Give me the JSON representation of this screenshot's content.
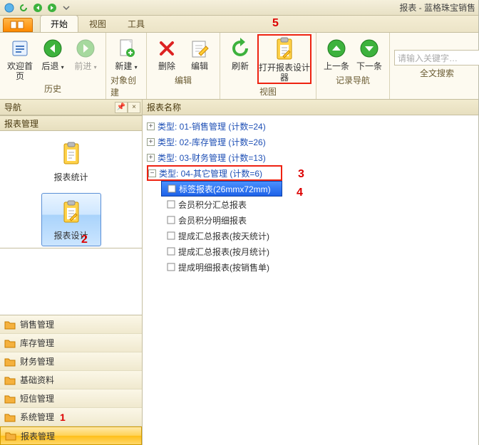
{
  "window": {
    "title": "报表 - 蓝格珠宝销售"
  },
  "qat": {
    "items": [
      {
        "name": "app-logo-icon",
        "glyph": "logo",
        "color": "#2a90d8"
      },
      {
        "name": "refresh-icon",
        "glyph": "refresh",
        "color": "#2fa82f"
      },
      {
        "name": "nav-back-icon",
        "glyph": "back-round",
        "color": "#2fa82f"
      },
      {
        "name": "nav-forward-icon",
        "glyph": "forward-round",
        "color": "#2fa82f"
      },
      {
        "name": "dropdown-icon",
        "glyph": "chevron-down",
        "color": "#888"
      }
    ]
  },
  "tabs": {
    "items": [
      {
        "label": "开始",
        "active": true
      },
      {
        "label": "视图",
        "active": false
      },
      {
        "label": "工具",
        "active": false
      }
    ]
  },
  "annotations": {
    "a1": "1",
    "a2": "2",
    "a3": "3",
    "a4": "4",
    "a5": "5"
  },
  "ribbon": {
    "groups": [
      {
        "label": "历史",
        "buttons": [
          {
            "name": "home-button",
            "label": "欢迎首页",
            "glyph": "home",
            "disabled": false
          },
          {
            "name": "back-button",
            "label": "后退",
            "glyph": "back-round",
            "disabled": false,
            "dropdown": true
          },
          {
            "name": "forward-button",
            "label": "前进",
            "glyph": "forward-round",
            "disabled": true,
            "dropdown": true
          }
        ]
      },
      {
        "label": "对象创建",
        "buttons": [
          {
            "name": "new-button",
            "label": "新建",
            "glyph": "new",
            "dropdown": true
          }
        ]
      },
      {
        "label": "编辑",
        "buttons": [
          {
            "name": "delete-button",
            "label": "删除",
            "glyph": "delete"
          },
          {
            "name": "edit-button",
            "label": "编辑",
            "glyph": "edit"
          }
        ]
      },
      {
        "label": "视图",
        "buttons": [
          {
            "name": "refresh-button",
            "label": "刷新",
            "glyph": "refresh-big"
          },
          {
            "name": "open-designer-button",
            "label": "打开报表设计器",
            "glyph": "clipboard",
            "wide": true,
            "highlight": true
          }
        ]
      },
      {
        "label": "记录导航",
        "buttons": [
          {
            "name": "prev-record-button",
            "label": "上一条",
            "glyph": "up-round"
          },
          {
            "name": "next-record-button",
            "label": "下一条",
            "glyph": "down-round"
          }
        ]
      },
      {
        "label": "全文搜索",
        "search": {
          "placeholder": "请输入关键字…"
        }
      }
    ]
  },
  "nav": {
    "title": "导航",
    "section_title": "报表管理",
    "cards": [
      {
        "name": "card-report-stats",
        "label": "报表统计",
        "glyph": "clipboard-plain",
        "selected": false
      },
      {
        "name": "card-report-design",
        "label": "报表设计",
        "glyph": "clipboard",
        "selected": true,
        "highlight": true
      }
    ],
    "items": [
      {
        "name": "sidebar-sales",
        "label": "销售管理"
      },
      {
        "name": "sidebar-inventory",
        "label": "库存管理"
      },
      {
        "name": "sidebar-finance",
        "label": "财务管理"
      },
      {
        "name": "sidebar-basic-data",
        "label": "基础资料"
      },
      {
        "name": "sidebar-sms",
        "label": "短信管理"
      },
      {
        "name": "sidebar-system",
        "label": "系统管理",
        "annotation": "1"
      },
      {
        "name": "sidebar-reports",
        "label": "报表管理",
        "selected": true,
        "highlight": true
      }
    ]
  },
  "content": {
    "header": "报表名称",
    "groups": [
      {
        "label": "类型: 01-销售管理 (计数=24)",
        "expanded": false
      },
      {
        "label": "类型: 02-库存管理 (计数=26)",
        "expanded": false
      },
      {
        "label": "类型: 03-财务管理 (计数=13)",
        "expanded": false
      },
      {
        "label": "类型: 04-其它管理 (计数=6)",
        "expanded": true,
        "highlight": true,
        "children": [
          {
            "label": "标签报表(26mmx72mm)",
            "selected": true,
            "highlight": true
          },
          {
            "label": "会员积分汇总报表"
          },
          {
            "label": "会员积分明细报表"
          },
          {
            "label": "提成汇总报表(按天统计)"
          },
          {
            "label": "提成汇总报表(按月统计)"
          },
          {
            "label": "提成明细报表(按销售单)"
          }
        ]
      }
    ]
  }
}
